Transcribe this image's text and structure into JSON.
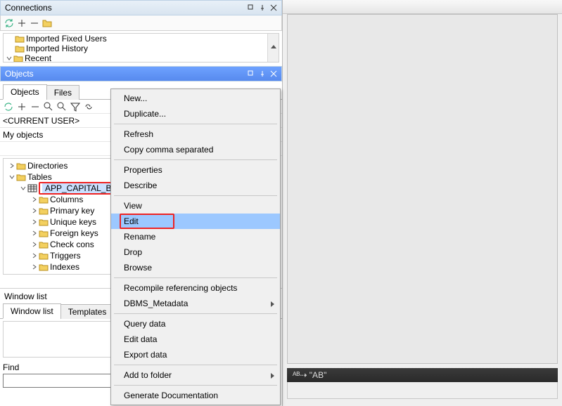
{
  "connections": {
    "title": "Connections",
    "tree": {
      "item0": "Imported Fixed Users",
      "item1": "Imported History",
      "item2": "Recent"
    }
  },
  "objects": {
    "title": "Objects",
    "tabs": {
      "objects": "Objects",
      "files": "Files"
    },
    "current_user": "<CURRENT USER>",
    "my_objects": "My objects",
    "tree": {
      "directories": "Directories",
      "tables": "Tables",
      "selected_table": "APP_CAPITAL_B",
      "columns": "Columns",
      "primary_key": "Primary key",
      "unique_keys": "Unique keys",
      "foreign_keys": "Foreign keys",
      "check_cons": "Check cons",
      "triggers": "Triggers",
      "indexes": "Indexes"
    }
  },
  "windowlist": {
    "title": "Window list",
    "tabs": {
      "windowlist": "Window list",
      "templates": "Templates"
    }
  },
  "find": {
    "label": "Find",
    "value": ""
  },
  "context_menu": {
    "new": "New...",
    "duplicate": "Duplicate...",
    "refresh": "Refresh",
    "copy": "Copy comma separated",
    "properties": "Properties",
    "describe": "Describe",
    "view": "View",
    "edit": "Edit",
    "rename": "Rename",
    "drop": "Drop",
    "browse": "Browse",
    "recompile": "Recompile referencing objects",
    "dbms": "DBMS_Metadata",
    "query": "Query data",
    "editdata": "Edit data",
    "export": "Export data",
    "addfolder": "Add to folder",
    "gendoc": "Generate Documentation"
  },
  "status": {
    "text": "ᴬᴮ⇢ \"AB\""
  }
}
